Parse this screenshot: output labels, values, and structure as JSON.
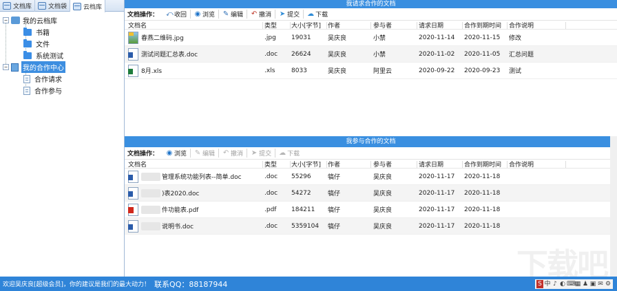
{
  "tabs": [
    {
      "label": "文档库",
      "icon": "doc-library-icon",
      "active": false
    },
    {
      "label": "文档袋",
      "icon": "doc-bag-icon",
      "active": false
    },
    {
      "label": "云档库",
      "icon": "cloud-library-icon",
      "active": true
    }
  ],
  "tree": {
    "root": "我的云档库",
    "folders": [
      "书籍",
      "文件",
      "系统测试"
    ],
    "center": "我的合作中心",
    "center_items": [
      "合作请求",
      "合作参与"
    ]
  },
  "columns": [
    "文档名",
    "类型",
    "大小[字节]",
    "作者",
    "参与者",
    "请求日期",
    "合作到期时间",
    "合作说明"
  ],
  "top_panel": {
    "title": "我请求合作的文档",
    "ops_label": "文档操作：",
    "ops": [
      {
        "label": "收回",
        "icon": "recall-icon"
      },
      {
        "label": "浏览",
        "icon": "view-icon"
      },
      {
        "label": "编辑",
        "icon": "edit-icon"
      },
      {
        "label": "撤消",
        "icon": "undo-icon"
      },
      {
        "label": "提交",
        "icon": "submit-icon"
      },
      {
        "label": "下载",
        "icon": "download-icon"
      }
    ],
    "rows": [
      {
        "name": "春燕二维码.jpg",
        "kind": "jpg",
        "type": ".jpg",
        "size": "19031",
        "author": "吴庆良",
        "participant": "小禁",
        "request_date": "2020-11-14",
        "due": "2020-11-15",
        "desc": "修改"
      },
      {
        "name": "测试问题汇总表.doc",
        "kind": "word",
        "type": ".doc",
        "size": "26624",
        "author": "吴庆良",
        "participant": "小禁",
        "request_date": "2020-11-02",
        "due": "2020-11-05",
        "desc": "汇总问题"
      },
      {
        "name": "8月.xls",
        "kind": "excel",
        "type": ".xls",
        "size": "8033",
        "author": "吴庆良",
        "participant": "阿里云",
        "request_date": "2020-09-22",
        "due": "2020-09-23",
        "desc": "测试"
      }
    ]
  },
  "bottom_panel": {
    "title": "我参与合作的文档",
    "ops_label": "文档操作：",
    "ops": [
      {
        "label": "浏览",
        "icon": "view-icon"
      },
      {
        "label": "编辑",
        "icon": "edit-icon"
      },
      {
        "label": "撤消",
        "icon": "undo-icon"
      },
      {
        "label": "提交",
        "icon": "submit-icon"
      },
      {
        "label": "下载",
        "icon": "download-icon"
      }
    ],
    "rows": [
      {
        "name": "管理系统功能列表--简单.doc",
        "kind": "word",
        "type": ".doc",
        "size": "55296",
        "author": "犒仔",
        "participant": "吴庆良",
        "request_date": "2020-11-17",
        "due": "2020-11-18",
        "desc": ""
      },
      {
        "name": ")表2020.doc",
        "kind": "word",
        "type": ".doc",
        "size": "54272",
        "author": "犒仔",
        "participant": "吴庆良",
        "request_date": "2020-11-17",
        "due": "2020-11-18",
        "desc": ""
      },
      {
        "name": "件功能表.pdf",
        "kind": "pdf",
        "type": ".pdf",
        "size": "184211",
        "author": "犒仔",
        "participant": "吴庆良",
        "request_date": "2020-11-17",
        "due": "2020-11-18",
        "desc": ""
      },
      {
        "name": "说明书.doc",
        "kind": "word",
        "type": ".doc",
        "size": "5359104",
        "author": "犒仔",
        "participant": "吴庆良",
        "request_date": "2020-11-17",
        "due": "2020-11-18",
        "desc": ""
      }
    ]
  },
  "status": {
    "message": "欢迎吴庆良[超级会员]，你的建议是我们的最大动力！",
    "qq": "联系QQ：88187944",
    "tray": [
      "S",
      "中",
      "♪",
      "◐",
      "⌨",
      "▦",
      "♟",
      "▣",
      "✉",
      "⚙"
    ]
  },
  "watermark": "下载吧",
  "colors": {
    "accent": "#3a8fe0",
    "status_bar": "#2f84d8",
    "selected": "#3d8ee0"
  }
}
